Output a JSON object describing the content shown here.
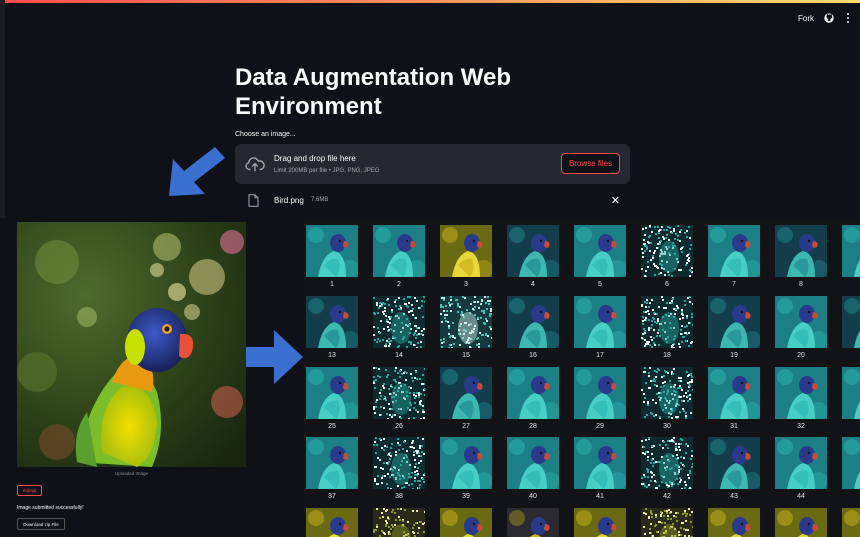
{
  "header": {
    "fork_label": "Fork"
  },
  "main": {
    "title": "Data Augmentation Web Environment",
    "uploader": {
      "label": "Choose an image...",
      "drop_title": "Drag and drop file here",
      "drop_sub": "Limit 200MB per file • JPG, PNG, JPEG",
      "browse_label": "Browse files",
      "file_name": "Bird.png",
      "file_size": "7.6MB"
    }
  },
  "preview": {
    "caption": "Uploaded Image",
    "submit_label": "Submit",
    "success_text": "Image submitted successfully!",
    "download_label": "Download zip File"
  },
  "augmented": {
    "labels": [
      "1",
      "2",
      "3",
      "4",
      "5",
      "6",
      "7",
      "8",
      "13",
      "14",
      "15",
      "16",
      "17",
      "18",
      "19",
      "20",
      "25",
      "26",
      "27",
      "28",
      "29",
      "30",
      "31",
      "32",
      "37",
      "38",
      "39",
      "40",
      "41",
      "42",
      "43",
      "44"
    ],
    "styles": [
      "teal",
      "teal",
      "yellow",
      "teal-dark",
      "teal",
      "noise",
      "teal",
      "teal-dark",
      "teal-dark",
      "noise",
      "noise-teal",
      "teal-dark",
      "teal",
      "noise",
      "teal-dark",
      "teal",
      "teal",
      "noise",
      "teal-dark",
      "teal",
      "teal",
      "noise",
      "teal",
      "teal",
      "teal",
      "noise",
      "teal",
      "teal",
      "teal",
      "noise",
      "teal-dark",
      "teal"
    ],
    "last_row_styles": [
      "yellow",
      "noise-yellow",
      "yellow",
      "yellow-dark",
      "yellow",
      "noise-yellow",
      "yellow",
      "yellow"
    ]
  },
  "colors": {
    "accent": "#ff4b4b",
    "arrow": "#3a6fd0",
    "background": "#0e1117"
  }
}
